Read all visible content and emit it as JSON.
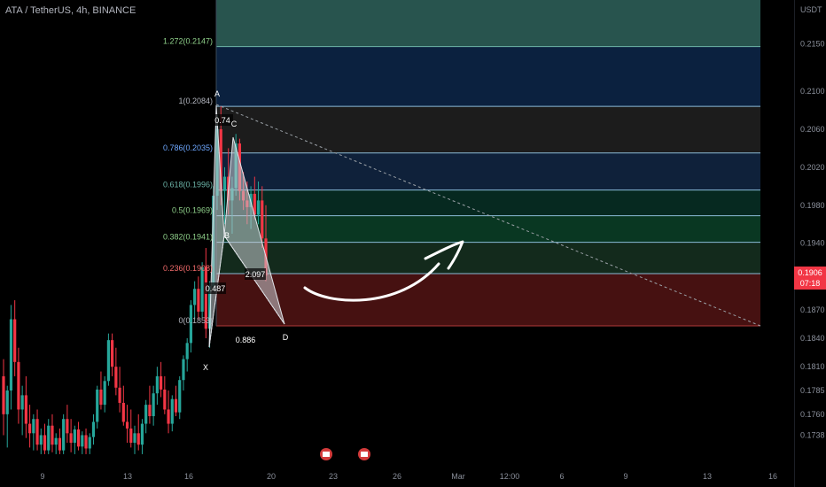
{
  "header": {
    "title": "ATA / TetherUS, 4h, BINANCE"
  },
  "axis": {
    "unit": "USDT",
    "last_price": "0.1906",
    "countdown": "07:18"
  },
  "colors": {
    "up": "#26a69a",
    "down": "#f23645",
    "background": "#000000",
    "axis_text": "#8a8f9a"
  },
  "chart_data": {
    "type": "candlestick",
    "symbol": "ATA / TetherUS",
    "interval": "4h",
    "exchange": "BINANCE",
    "y_scale": "linear",
    "ylim": [
      0.172,
      0.2185
    ],
    "y_ticks": [
      "0.2150",
      "0.2100",
      "0.2060",
      "0.2020",
      "0.1980",
      "0.1940",
      "0.1906",
      "0.1870",
      "0.1840",
      "0.1810",
      "0.1785",
      "0.1760",
      "0.1738"
    ],
    "x_ticks": [
      "9",
      "13",
      "16",
      "20",
      "23",
      "26",
      "Mar",
      "12:00",
      "6",
      "9",
      "13",
      "16"
    ],
    "grid": false,
    "fib_levels": [
      {
        "label": "1.272(0.2147)",
        "ratio": 1.272,
        "price": 0.2147,
        "zone_color": "#2a5952"
      },
      {
        "label": "1(0.2084)",
        "ratio": 1.0,
        "price": 0.2084,
        "zone_color": "#0c2342"
      },
      {
        "label": "0.786(0.2035)",
        "ratio": 0.786,
        "price": 0.2035,
        "zone_color": "#1e1e1e"
      },
      {
        "label": "0.618(0.1996)",
        "ratio": 0.618,
        "price": 0.1996,
        "zone_color": "#10233d"
      },
      {
        "label": "0.5(0.1969)",
        "ratio": 0.5,
        "price": 0.1969,
        "zone_color": "#062b22"
      },
      {
        "label": "0.382(0.1941)",
        "ratio": 0.382,
        "price": 0.1941,
        "zone_color": "#0a3a24"
      },
      {
        "label": "0.236(0.1908)",
        "ratio": 0.236,
        "price": 0.1908,
        "zone_color": "#142c1d"
      },
      {
        "label": "0(0.1853)",
        "ratio": 0.0,
        "price": 0.1853,
        "zone_color": "#4a1212"
      }
    ],
    "harmonic_points": [
      "X",
      "A",
      "B",
      "C",
      "D"
    ],
    "harmonic_ratios": [
      "0.74",
      "0.487",
      "2.097",
      "0.886"
    ],
    "candles": [
      {
        "o": 0.18,
        "h": 0.1818,
        "l": 0.1738,
        "c": 0.176
      },
      {
        "o": 0.176,
        "h": 0.179,
        "l": 0.1725,
        "c": 0.1785
      },
      {
        "o": 0.1785,
        "h": 0.1875,
        "l": 0.1765,
        "c": 0.186
      },
      {
        "o": 0.186,
        "h": 0.188,
        "l": 0.18,
        "c": 0.1815
      },
      {
        "o": 0.1815,
        "h": 0.183,
        "l": 0.175,
        "c": 0.1765
      },
      {
        "o": 0.1765,
        "h": 0.179,
        "l": 0.1738,
        "c": 0.178
      },
      {
        "o": 0.178,
        "h": 0.18,
        "l": 0.1735,
        "c": 0.175
      },
      {
        "o": 0.175,
        "h": 0.177,
        "l": 0.1725,
        "c": 0.174
      },
      {
        "o": 0.174,
        "h": 0.176,
        "l": 0.1722,
        "c": 0.1755
      },
      {
        "o": 0.1755,
        "h": 0.1765,
        "l": 0.1722,
        "c": 0.1728
      },
      {
        "o": 0.1728,
        "h": 0.1745,
        "l": 0.1718,
        "c": 0.1738
      },
      {
        "o": 0.1738,
        "h": 0.175,
        "l": 0.1718,
        "c": 0.1722
      },
      {
        "o": 0.1722,
        "h": 0.1755,
        "l": 0.1718,
        "c": 0.1748
      },
      {
        "o": 0.1748,
        "h": 0.176,
        "l": 0.172,
        "c": 0.1728
      },
      {
        "o": 0.1728,
        "h": 0.174,
        "l": 0.1718,
        "c": 0.1735
      },
      {
        "o": 0.1735,
        "h": 0.1745,
        "l": 0.1718,
        "c": 0.1722
      },
      {
        "o": 0.1722,
        "h": 0.176,
        "l": 0.1718,
        "c": 0.1755
      },
      {
        "o": 0.1755,
        "h": 0.177,
        "l": 0.173,
        "c": 0.174
      },
      {
        "o": 0.174,
        "h": 0.1755,
        "l": 0.172,
        "c": 0.173
      },
      {
        "o": 0.173,
        "h": 0.1748,
        "l": 0.1718,
        "c": 0.1744
      },
      {
        "o": 0.1744,
        "h": 0.1752,
        "l": 0.1722,
        "c": 0.1726
      },
      {
        "o": 0.1726,
        "h": 0.1742,
        "l": 0.1718,
        "c": 0.1738
      },
      {
        "o": 0.1738,
        "h": 0.1745,
        "l": 0.1718,
        "c": 0.1724
      },
      {
        "o": 0.1724,
        "h": 0.174,
        "l": 0.1718,
        "c": 0.1736
      },
      {
        "o": 0.1736,
        "h": 0.176,
        "l": 0.1728,
        "c": 0.1752
      },
      {
        "o": 0.1752,
        "h": 0.179,
        "l": 0.1745,
        "c": 0.1786
      },
      {
        "o": 0.1786,
        "h": 0.1805,
        "l": 0.1765,
        "c": 0.177
      },
      {
        "o": 0.177,
        "h": 0.18,
        "l": 0.1762,
        "c": 0.1795
      },
      {
        "o": 0.1795,
        "h": 0.1845,
        "l": 0.179,
        "c": 0.1838
      },
      {
        "o": 0.1838,
        "h": 0.1845,
        "l": 0.18,
        "c": 0.181
      },
      {
        "o": 0.181,
        "h": 0.183,
        "l": 0.178,
        "c": 0.1788
      },
      {
        "o": 0.1788,
        "h": 0.181,
        "l": 0.1762,
        "c": 0.1772
      },
      {
        "o": 0.1772,
        "h": 0.179,
        "l": 0.1748,
        "c": 0.1752
      },
      {
        "o": 0.1752,
        "h": 0.177,
        "l": 0.173,
        "c": 0.1745
      },
      {
        "o": 0.1745,
        "h": 0.1765,
        "l": 0.1725,
        "c": 0.173
      },
      {
        "o": 0.173,
        "h": 0.1748,
        "l": 0.1718,
        "c": 0.174
      },
      {
        "o": 0.174,
        "h": 0.176,
        "l": 0.1722,
        "c": 0.1728
      },
      {
        "o": 0.1728,
        "h": 0.1755,
        "l": 0.1718,
        "c": 0.175
      },
      {
        "o": 0.175,
        "h": 0.1775,
        "l": 0.174,
        "c": 0.177
      },
      {
        "o": 0.177,
        "h": 0.179,
        "l": 0.175,
        "c": 0.1758
      },
      {
        "o": 0.1758,
        "h": 0.179,
        "l": 0.1748,
        "c": 0.1782
      },
      {
        "o": 0.1782,
        "h": 0.181,
        "l": 0.177,
        "c": 0.18
      },
      {
        "o": 0.18,
        "h": 0.1815,
        "l": 0.1778,
        "c": 0.1786
      },
      {
        "o": 0.1786,
        "h": 0.18,
        "l": 0.176,
        "c": 0.1765
      },
      {
        "o": 0.1765,
        "h": 0.1785,
        "l": 0.174,
        "c": 0.175
      },
      {
        "o": 0.175,
        "h": 0.178,
        "l": 0.1742,
        "c": 0.1776
      },
      {
        "o": 0.1776,
        "h": 0.179,
        "l": 0.1758,
        "c": 0.1762
      },
      {
        "o": 0.1762,
        "h": 0.18,
        "l": 0.1755,
        "c": 0.1796
      },
      {
        "o": 0.1796,
        "h": 0.1822,
        "l": 0.1785,
        "c": 0.1818
      },
      {
        "o": 0.1818,
        "h": 0.184,
        "l": 0.1805,
        "c": 0.1835
      },
      {
        "o": 0.1835,
        "h": 0.188,
        "l": 0.1825,
        "c": 0.1875
      },
      {
        "o": 0.1875,
        "h": 0.19,
        "l": 0.186,
        "c": 0.1892
      },
      {
        "o": 0.1892,
        "h": 0.1905,
        "l": 0.186,
        "c": 0.1868
      },
      {
        "o": 0.1868,
        "h": 0.192,
        "l": 0.1862,
        "c": 0.1915
      },
      {
        "o": 0.1915,
        "h": 0.1935,
        "l": 0.184,
        "c": 0.185
      },
      {
        "o": 0.185,
        "h": 0.19,
        "l": 0.183,
        "c": 0.1895
      },
      {
        "o": 0.1895,
        "h": 0.2,
        "l": 0.189,
        "c": 0.199
      },
      {
        "o": 0.199,
        "h": 0.2075,
        "l": 0.1975,
        "c": 0.206
      },
      {
        "o": 0.206,
        "h": 0.2084,
        "l": 0.198,
        "c": 0.1995
      },
      {
        "o": 0.1995,
        "h": 0.202,
        "l": 0.196,
        "c": 0.201
      },
      {
        "o": 0.201,
        "h": 0.204,
        "l": 0.197,
        "c": 0.1985
      },
      {
        "o": 0.1985,
        "h": 0.201,
        "l": 0.195,
        "c": 0.1998
      },
      {
        "o": 0.1998,
        "h": 0.2055,
        "l": 0.199,
        "c": 0.2045
      },
      {
        "o": 0.2045,
        "h": 0.205,
        "l": 0.1985,
        "c": 0.1995
      },
      {
        "o": 0.1995,
        "h": 0.2015,
        "l": 0.1975,
        "c": 0.1985
      },
      {
        "o": 0.1985,
        "h": 0.2005,
        "l": 0.196,
        "c": 0.1978
      },
      {
        "o": 0.1978,
        "h": 0.2,
        "l": 0.1955,
        "c": 0.1992
      },
      {
        "o": 0.1992,
        "h": 0.201,
        "l": 0.1965,
        "c": 0.197
      },
      {
        "o": 0.197,
        "h": 0.2005,
        "l": 0.196,
        "c": 0.1985
      },
      {
        "o": 0.1985,
        "h": 0.2,
        "l": 0.1935,
        "c": 0.1945
      },
      {
        "o": 0.1945,
        "h": 0.198,
        "l": 0.19,
        "c": 0.1906
      }
    ]
  }
}
